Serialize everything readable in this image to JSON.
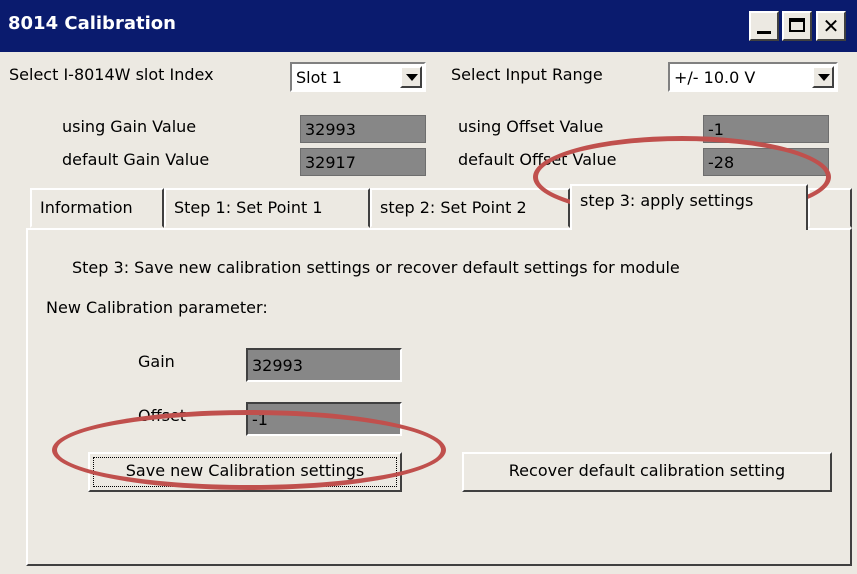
{
  "window": {
    "title": "8014 Calibration"
  },
  "titlebar_buttons": [
    "minimize-icon",
    "maximize-icon",
    "close-icon"
  ],
  "close_glyph": "✕",
  "slot": {
    "label": "Select I-8014W slot Index",
    "value": "Slot 1"
  },
  "range": {
    "label": "Select Input Range",
    "value": "+/- 10.0 V"
  },
  "values": {
    "using_gain_label": "using Gain Value",
    "using_gain": "32993",
    "default_gain_label": "default Gain Value",
    "default_gain": "32917",
    "using_offset_label": "using Offset Value",
    "using_offset": "-1",
    "default_offset_label": "default Offset Value",
    "default_offset": "-28"
  },
  "tabs": [
    {
      "label": "Information"
    },
    {
      "label": "Step 1: Set Point 1"
    },
    {
      "label": "step 2: Set Point 2"
    },
    {
      "label": "step 3: apply settings",
      "active": true
    }
  ],
  "step3": {
    "heading": "Step 3: Save new calibration settings or recover default settings for module",
    "param_label": "New Calibration parameter:",
    "gain_label": "Gain",
    "gain_value": "32993",
    "offset_label": "Offset",
    "offset_value": "-1",
    "save_button": "Save new Calibration settings",
    "recover_button": "Recover default calibration setting"
  },
  "colors": {
    "titlebar": "#0a1b6e",
    "window": "#ece9e2",
    "readonly_field": "#878787",
    "annotation": "#c0504d"
  }
}
